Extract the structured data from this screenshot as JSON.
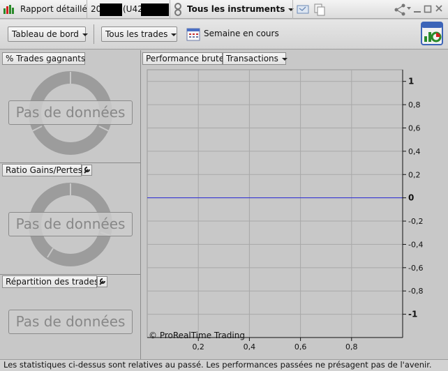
{
  "titlebar": {
    "report_label": "Rapport détaillé",
    "account_prefix": "20",
    "account_mid": "(U42",
    "instruments_label": "Tous les instruments"
  },
  "toolbar": {
    "dashboard_label": "Tableau de bord",
    "trades_label": "Tous les trades",
    "period_label": "Semaine en cours"
  },
  "panels": {
    "winning_trades": {
      "title": "% Trades gagnants",
      "no_data": "Pas de données"
    },
    "gain_loss_ratio": {
      "title": "Ratio Gains/Pertes",
      "no_data": "Pas de données"
    },
    "trade_distribution": {
      "title": "Répartition des trades",
      "no_data": "Pas de données"
    }
  },
  "performance": {
    "title": "Performance brute",
    "view_label": "Transactions"
  },
  "chart_data": {
    "type": "line",
    "series": [
      {
        "values": [
          0,
          0
        ],
        "x": [
          0,
          1
        ],
        "color": "#2a2ad8"
      }
    ],
    "xlim": [
      0,
      1
    ],
    "ylim": [
      -1.2,
      1.1
    ],
    "x_ticks": [
      "0,2",
      "0,4",
      "0,6",
      "0,8"
    ],
    "x_tick_values": [
      0.2,
      0.4,
      0.6,
      0.8
    ],
    "y_ticks": [
      "1",
      "0,8",
      "0,6",
      "0,4",
      "0,2",
      "0",
      "-0,2",
      "-0,4",
      "-0,6",
      "-0,8",
      "-1"
    ],
    "y_tick_values": [
      1,
      0.8,
      0.6,
      0.4,
      0.2,
      0,
      -0.2,
      -0.4,
      -0.6,
      -0.8,
      -1
    ],
    "grid": true,
    "watermark": "© ProRealTime Trading"
  },
  "disclaimer": "Les statistiques ci-dessus sont relatives au passé. Les performances passées ne présagent pas de l'avenir.",
  "colors": {
    "donut": "#9c9c9c",
    "line": "#2a2ad8",
    "background": "#c8c8c8"
  }
}
